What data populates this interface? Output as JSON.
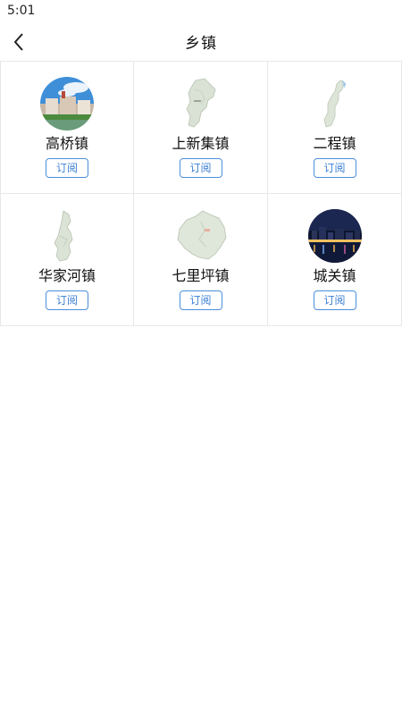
{
  "status_bar": {
    "time": "5:01"
  },
  "header": {
    "title": "乡镇",
    "back_icon": "chevron-left-icon"
  },
  "towns": [
    {
      "name": "高桥镇",
      "button": "订阅",
      "image": "photo-town-buildings"
    },
    {
      "name": "上新集镇",
      "button": "订阅",
      "image": "map-outline"
    },
    {
      "name": "二程镇",
      "button": "订阅",
      "image": "map-outline"
    },
    {
      "name": "华家河镇",
      "button": "订阅",
      "image": "map-outline"
    },
    {
      "name": "七里坪镇",
      "button": "订阅",
      "image": "map-outline"
    },
    {
      "name": "城关镇",
      "button": "订阅",
      "image": "photo-night-city"
    }
  ],
  "colors": {
    "accent": "#4a90d9",
    "border": "#e8e8e8",
    "text": "#111111"
  }
}
